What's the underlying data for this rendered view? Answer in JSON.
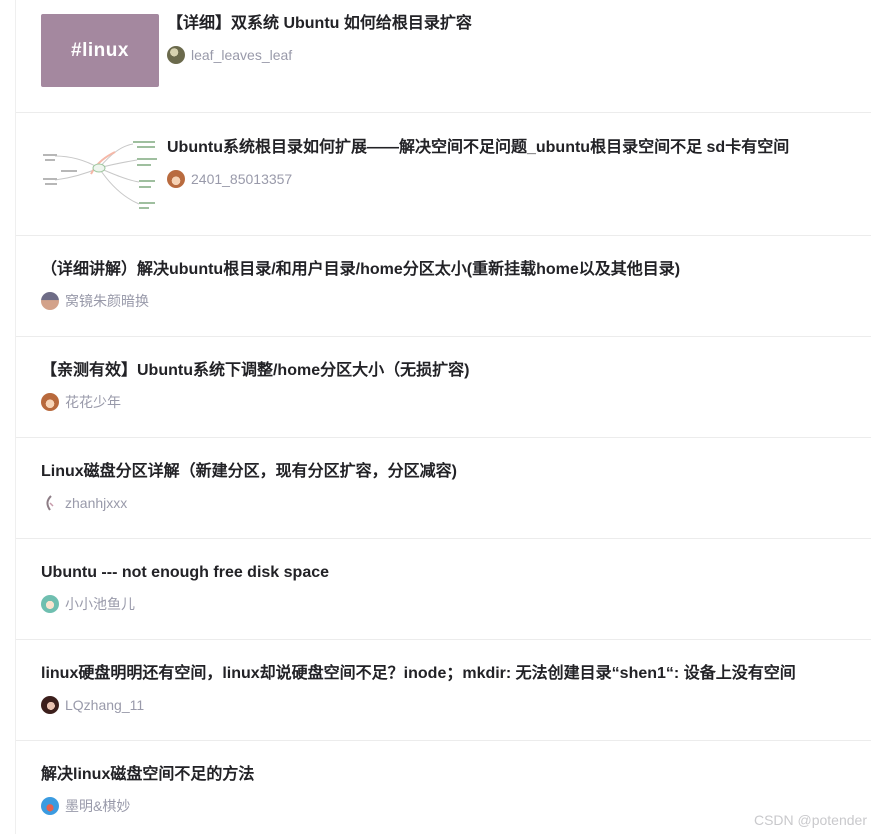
{
  "articles": [
    {
      "title": "【详细】双系统 Ubuntu 如何给根目录扩容",
      "author": "leaf_leaves_leaf",
      "thumbnail": {
        "text": "#linux",
        "color": "#a4889f"
      },
      "avatar_color": "#6b6a4c"
    },
    {
      "title": "Ubuntu系统根目录如何扩展——解决空间不足问题_ubuntu根目录空间不足 sd卡有空间",
      "author": "2401_85013357",
      "thumbnail": {
        "kind": "mind-map"
      },
      "avatar_color": "#e39d6f"
    },
    {
      "title": "（详细讲解）解决ubuntu根目录/和用户目录/home分区太小(重新挂载home以及其他目录)",
      "author": "窝镜朱颜暗换",
      "avatar_color": "#8a7b8c"
    },
    {
      "title": "【亲测有效】Ubuntu系统下调整/home分区大小（无损扩容)",
      "author": "花花少年",
      "avatar_color": "#e29a66"
    },
    {
      "title": "Linux磁盘分区详解（新建分区，现有分区扩容，分区减容)",
      "author": "zhanhjxxx",
      "avatar_color": "#b49aa8"
    },
    {
      "title": "Ubuntu --- not enough free disk space",
      "author": "小小池鱼儿",
      "avatar_color": "#7dc3b4"
    },
    {
      "title": "linux硬盘明明还有空间，linux却说硬盘空间不足？inode；mkdir: 无法创建目录“shen1“: 设备上没有空间",
      "author": "LQzhang_11",
      "avatar_color": "#5a2c28"
    },
    {
      "title": "解决linux磁盘空间不足的方法",
      "author": "墨明&棋妙",
      "avatar_color": "#3b9be0"
    }
  ],
  "watermark": "CSDN @potender"
}
